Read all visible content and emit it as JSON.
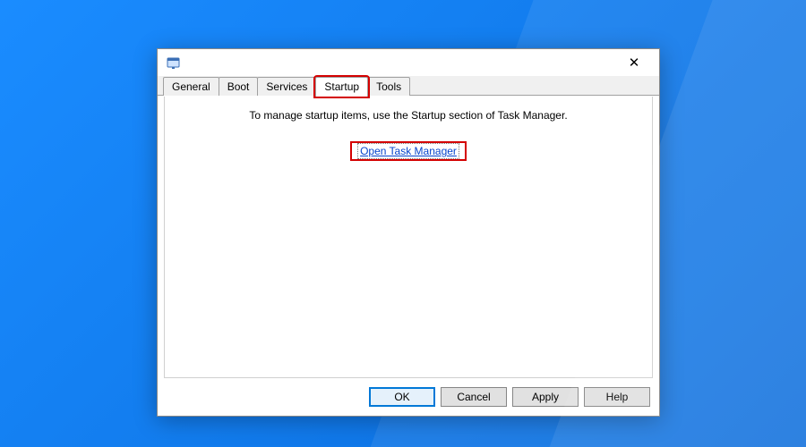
{
  "tabs": {
    "general": "General",
    "boot": "Boot",
    "services": "Services",
    "startup": "Startup",
    "tools": "Tools",
    "active": "startup"
  },
  "pane": {
    "message": "To manage startup items, use the Startup section of Task Manager.",
    "link": "Open Task Manager"
  },
  "buttons": {
    "ok": "OK",
    "cancel": "Cancel",
    "apply": "Apply",
    "help": "Help"
  },
  "highlights": {
    "tab": "startup",
    "link": true
  }
}
